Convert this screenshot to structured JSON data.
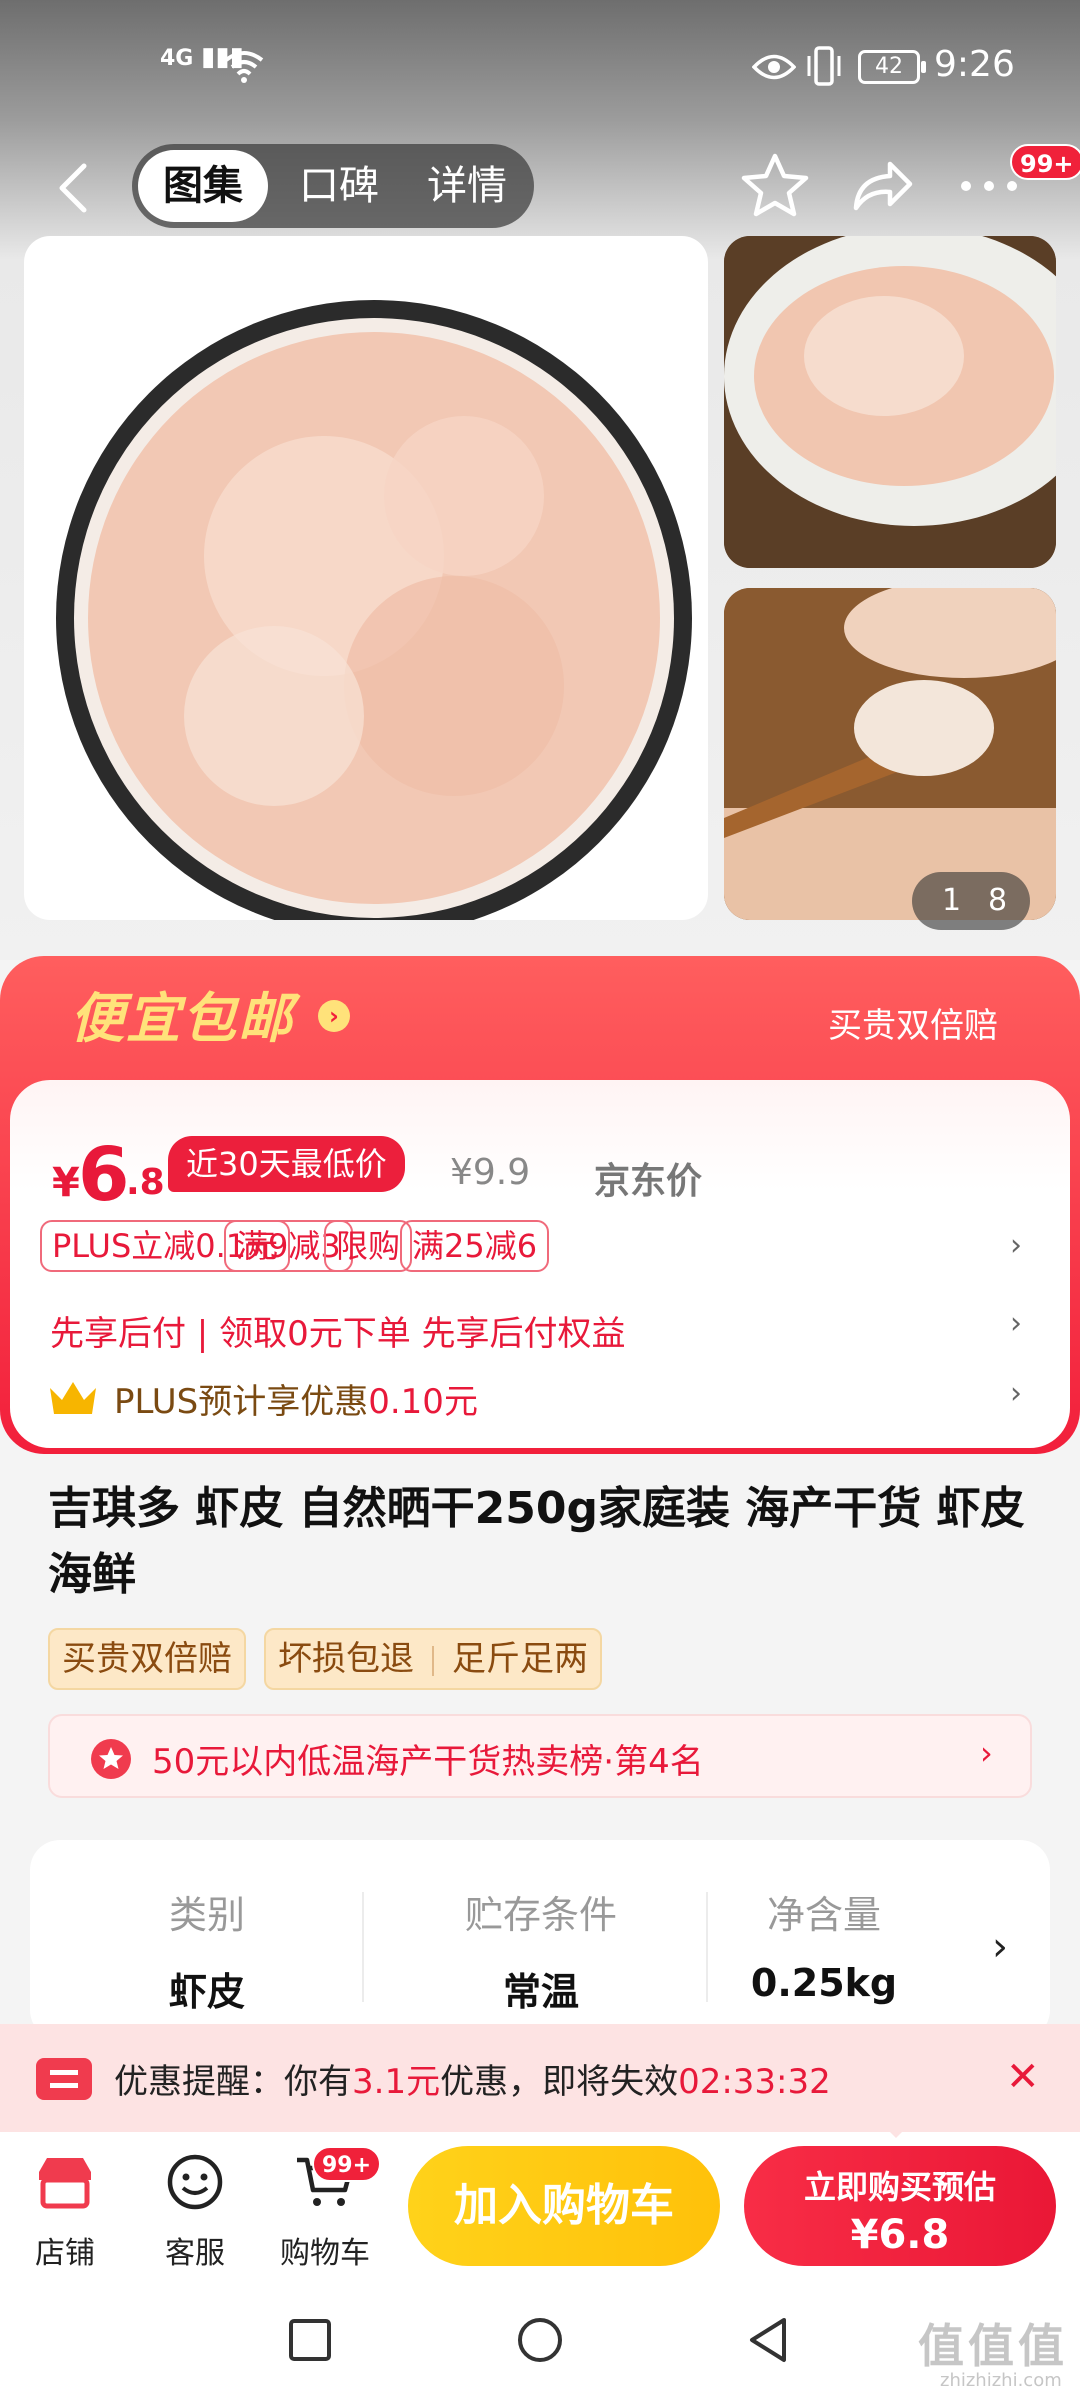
{
  "status_bar": {
    "network": "4G",
    "battery": "42",
    "time": "9:26"
  },
  "nav": {
    "tabs": [
      {
        "label": "图集",
        "active": true
      },
      {
        "label": "口碑",
        "active": false
      },
      {
        "label": "详情",
        "active": false
      }
    ],
    "message_badge": "99+",
    "icons": [
      "back-icon",
      "star-icon",
      "share-icon",
      "more-icon"
    ]
  },
  "gallery": {
    "counter_current": "1",
    "counter_total": "8"
  },
  "promo": {
    "title": "便宜包邮",
    "right_text": "买贵双倍赔",
    "price_symbol": "¥",
    "price_int": "6",
    "price_dec": ".8",
    "low_tag": "近30天最低价",
    "jd_price": "¥9.9",
    "jd_label": "京东价",
    "chips": [
      "PLUS立减0.1元",
      "满9减3",
      "限购",
      "满25减6"
    ],
    "pay_line": "先享后付 | 领取0元下单 先享后付权益",
    "plus_line_prefix": "PLUS预计享优惠",
    "plus_line_value": "0.10元"
  },
  "product": {
    "title": "吉琪多 虾皮 自然晒干250g家庭装 海产干货 虾皮海鲜",
    "tag1": "买贵双倍赔",
    "tag2a": "坏损包退",
    "tag2b": "足斤足两",
    "rank_text": "50元以内低温海产干货热卖榜·第4名"
  },
  "specs": [
    {
      "key": "类别",
      "value": "虾皮"
    },
    {
      "key": "贮存条件",
      "value": "常温"
    },
    {
      "key": "净含量",
      "value": "0.25kg"
    }
  ],
  "coupon": {
    "prefix": "优惠提醒：你有",
    "amount": "3.1元",
    "middle": "优惠，即将失效",
    "countdown": "02:33:32"
  },
  "action_bar": {
    "store": "店铺",
    "service": "客服",
    "cart": "购物车",
    "cart_badge": "99+",
    "add_cart": "加入购物车",
    "buy_line1": "立即购买预估",
    "buy_line2": "¥6.8"
  },
  "watermark": {
    "text": "值值值",
    "url": "zhizhizhi.com"
  },
  "colors": {
    "primary_red": "#e8193a",
    "promo_gold": "#ffe27a",
    "cart_yellow": "#ffc10a"
  }
}
